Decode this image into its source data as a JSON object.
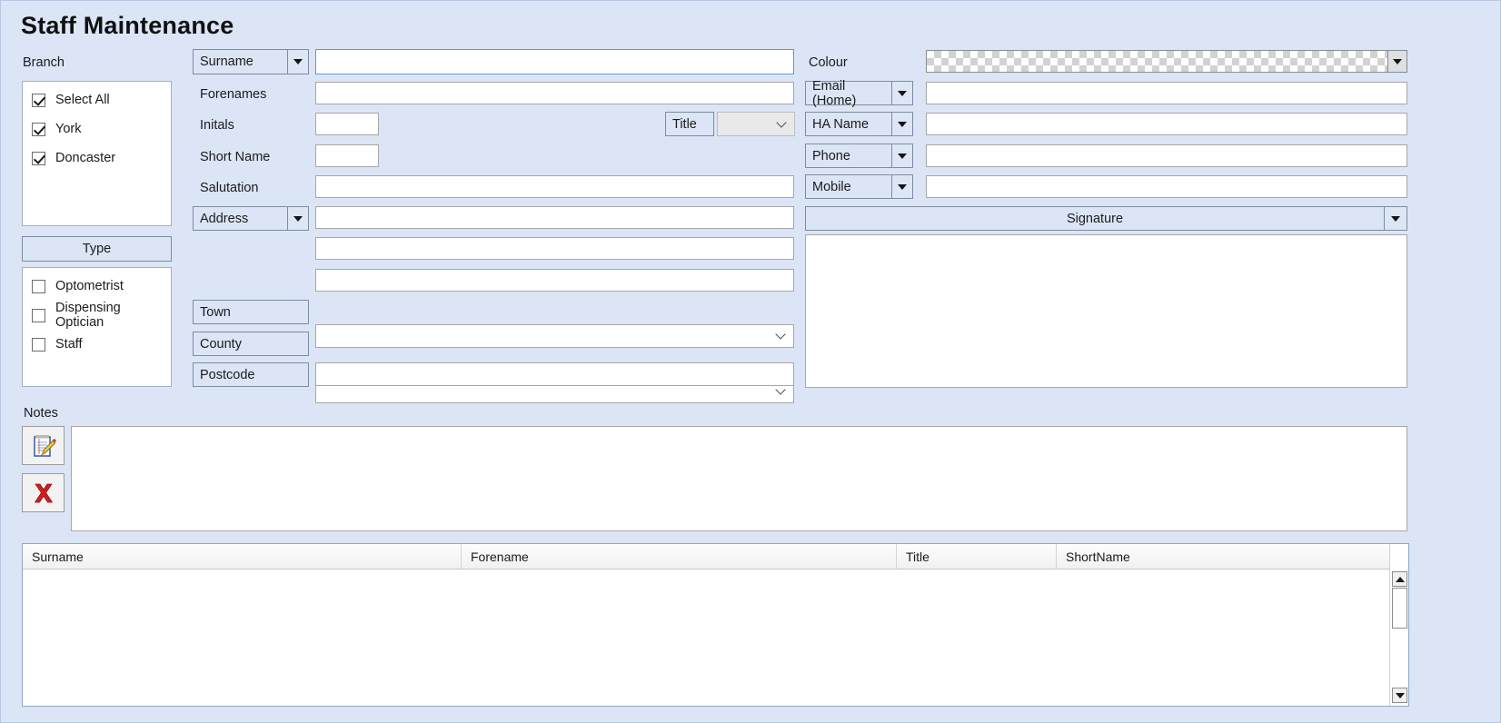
{
  "window": {
    "title": "Staff Maintenance"
  },
  "branch": {
    "label": "Branch",
    "items": [
      {
        "label": "Select All",
        "checked": true
      },
      {
        "label": "York",
        "checked": true
      },
      {
        "label": "Doncaster",
        "checked": true
      }
    ]
  },
  "type": {
    "header": "Type",
    "items": [
      {
        "label": "Optometrist",
        "checked": false
      },
      {
        "label": "Dispensing Optician",
        "checked": false
      },
      {
        "label": "Staff",
        "checked": false
      }
    ]
  },
  "name_fields": {
    "surname": {
      "label": "Surname",
      "value": "",
      "is_combo": true
    },
    "forenames": {
      "label": "Forenames",
      "value": ""
    },
    "initials": {
      "label": "Initals",
      "value": ""
    },
    "short_name": {
      "label": "Short Name",
      "value": ""
    },
    "salutation": {
      "label": "Salutation",
      "value": ""
    },
    "title": {
      "label": "Title",
      "value": ""
    }
  },
  "address": {
    "label": "Address",
    "is_combo": true,
    "line1": "",
    "line2": "",
    "line3": "",
    "town": {
      "label": "Town",
      "value": ""
    },
    "county": {
      "label": "County",
      "value": ""
    },
    "postcode": {
      "label": "Postcode",
      "value": ""
    }
  },
  "contact": {
    "colour": {
      "label": "Colour",
      "swatch": "transparent"
    },
    "rows": [
      {
        "label": "Email (Home)",
        "value": ""
      },
      {
        "label": "HA Name",
        "value": ""
      },
      {
        "label": "Phone",
        "value": ""
      },
      {
        "label": "Mobile",
        "value": ""
      }
    ],
    "signature": {
      "label": "Signature",
      "value": ""
    }
  },
  "notes": {
    "label": "Notes",
    "value": "",
    "buttons": [
      {
        "name": "edit-note-button",
        "icon": "notepad-pencil-icon"
      },
      {
        "name": "delete-note-button",
        "icon": "red-cross-icon"
      }
    ]
  },
  "grid": {
    "columns": [
      "Surname",
      "Forename",
      "Title",
      "ShortName"
    ],
    "rows": []
  },
  "colors": {
    "background": "#dbe5f6",
    "plate": "#dbe5f6",
    "border": "#7f8c9e",
    "input_border": "#a7a7a7",
    "focus_border": "#5a9ada",
    "red_cross": "#cc1f1f"
  }
}
